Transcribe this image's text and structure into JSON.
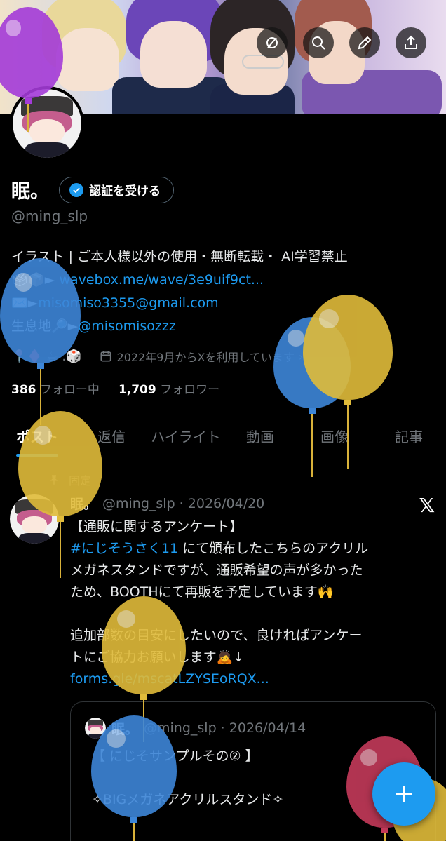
{
  "profile": {
    "display_name": "眠。",
    "verify_label": "認証を受ける",
    "handle": "@ming_slp",
    "bio_line1": "イラスト | ご本人様以外の使用・無断転載・ AI学習禁止",
    "bio_line2_prefix": "🗳📦►",
    "bio_line2_link": "wavebox.me/wave/3e9uif9ct...",
    "bio_line3_prefix": "✉️►",
    "bio_line3_link": "misomiso3355@gmail.com",
    "bio_line4_prefix": "生息地🔎►",
    "bio_line4_link": "@misomisozzz",
    "meta_emojis": "📍♦️ ☕ .🎲",
    "joined": "2022年9月からXを利用しています",
    "following_count": "386",
    "following_label": "フォロー中",
    "followers_count": "1,709",
    "followers_label": "フォロワー"
  },
  "tabs": [
    {
      "label": "ポスト"
    },
    {
      "label": "返信"
    },
    {
      "label": "ハイライト"
    },
    {
      "label": "動画"
    },
    {
      "label": "画像"
    },
    {
      "label": "記事"
    }
  ],
  "post": {
    "pinned_label": "固定",
    "author": "眠。",
    "handle_date": "@ming_slp · 2026/04/20",
    "line1": "【通販に関するアンケート】",
    "hashtag": "#にじそうさく11",
    "line2_rest": " にて頒布したこちらのアクリル",
    "line3": "メガネスタンドですが、通販希望の声が多かった",
    "line4": "ため、BOOTHにて再販を予定しています🙌",
    "line5": "追加部数の目安にしたいので、良ければアンケー",
    "line6": "トにご協力お願いします🙇↓",
    "link": "forms.gle/mscatLZYSEoRQX..."
  },
  "quote": {
    "author": "眠。",
    "handle_date": "@ming_slp · 2026/04/14",
    "line1": "【 にじそサンプルその② 】",
    "line2": "✧BIGメガネアクリルスタンド✧"
  },
  "icons": {
    "top_actions": [
      "circle-slash-icon",
      "search-icon",
      "edit-icon",
      "share-icon"
    ],
    "fab": "plus-icon"
  },
  "colors": {
    "accent": "#1d9bf0",
    "muted": "#71767b",
    "background": "#000000"
  }
}
